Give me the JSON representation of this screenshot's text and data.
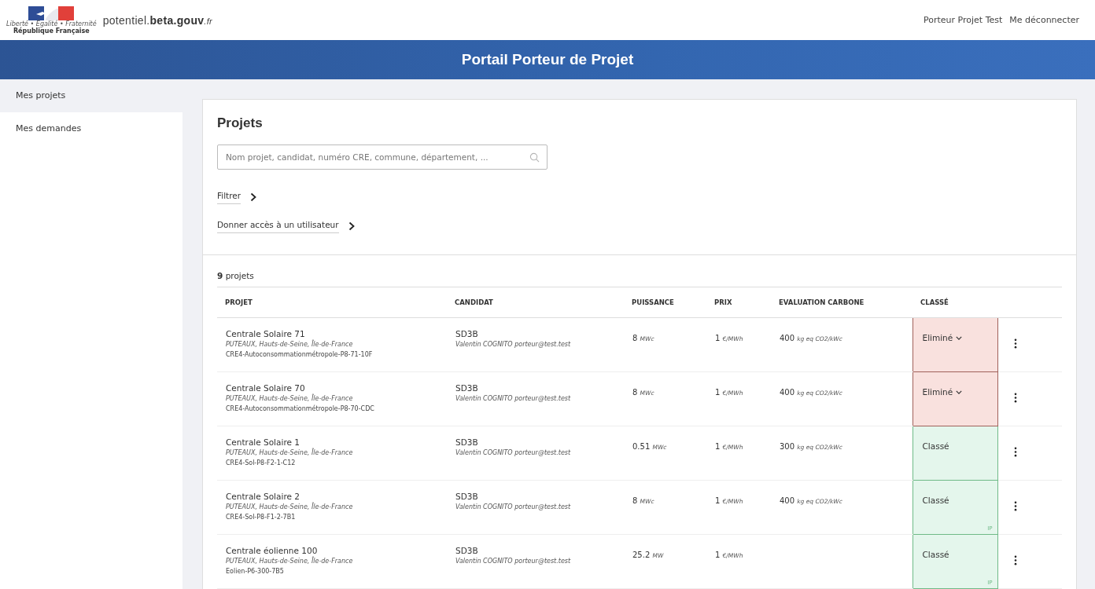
{
  "header": {
    "logo": {
      "motto": "Liberté • Égalité • Fraternité",
      "republic": "République Française"
    },
    "site": {
      "name": "potentiel.",
      "bold": "beta.gouv",
      "suffix": ".fr"
    },
    "links": [
      "Porteur Projet Test",
      "Me déconnecter"
    ]
  },
  "banner": {
    "title": "Portail Porteur de Projet"
  },
  "sidebar": {
    "items": [
      {
        "label": "Mes projets",
        "selected": true
      },
      {
        "label": "Mes demandes",
        "selected": false
      }
    ]
  },
  "main": {
    "title": "Projets",
    "search": {
      "placeholder": "Nom projet, candidat, numéro CRE, commune, département, ..."
    },
    "toggles": [
      "Filtrer",
      "Donner accès à un utilisateur"
    ],
    "count": "**9** projets",
    "table": {
      "columns": [
        "PROJET",
        "CANDIDAT",
        "PUISSANCE",
        "PRIX",
        "EVALUATION CARBONE",
        "CLASSÉ"
      ],
      "rows": [
        {
          "name": "Centrale Solaire 71",
          "location": "PUTEAUX, Hauts-de-Seine, Île-de-France",
          "code": "CRE4-Autoconsommationmétropole-P8-71-10F",
          "candidate": "SD3B",
          "contact": "Valentin COGNITO porteur@test.test",
          "power": {
            "value": "8",
            "unit": "MWc"
          },
          "price": {
            "value": "1",
            "unit": "€/MWh"
          },
          "carbon": {
            "value": "400",
            "unit": "kg eq CO2/kWc"
          },
          "status": {
            "kind": "elimine",
            "label": "Eliminé",
            "dropdown": true
          }
        },
        {
          "name": "Centrale Solaire 70",
          "location": "PUTEAUX, Hauts-de-Seine, Île-de-France",
          "code": "CRE4-Autoconsommationmétropole-P8-70-CDC",
          "candidate": "SD3B",
          "contact": "Valentin COGNITO porteur@test.test",
          "power": {
            "value": "8",
            "unit": "MWc"
          },
          "price": {
            "value": "1",
            "unit": "€/MWh"
          },
          "carbon": {
            "value": "400",
            "unit": "kg eq CO2/kWc"
          },
          "status": {
            "kind": "elimine",
            "label": "Eliminé",
            "dropdown": true
          }
        },
        {
          "name": "Centrale Solaire 1",
          "location": "PUTEAUX, Hauts-de-Seine, Île-de-France",
          "code": "CRE4-Sol-P8-F2-1-C12",
          "candidate": "SD3B",
          "contact": "Valentin COGNITO porteur@test.test",
          "power": {
            "value": "0.51",
            "unit": "MWc"
          },
          "price": {
            "value": "1",
            "unit": "€/MWh"
          },
          "carbon": {
            "value": "300",
            "unit": "kg eq CO2/kWc"
          },
          "status": {
            "kind": "classe",
            "label": "Classé",
            "dropdown": false
          }
        },
        {
          "name": "Centrale Solaire 2",
          "location": "PUTEAUX, Hauts-de-Seine, Île-de-France",
          "code": "CRE4-Sol-P8-F1-2-7B1",
          "candidate": "SD3B",
          "contact": "Valentin COGNITO porteur@test.test",
          "power": {
            "value": "8",
            "unit": "MWc"
          },
          "price": {
            "value": "1",
            "unit": "€/MWh"
          },
          "carbon": {
            "value": "400",
            "unit": "kg eq CO2/kWc"
          },
          "status": {
            "kind": "classe",
            "label": "Classé",
            "dropdown": false,
            "badge": "IP"
          }
        },
        {
          "name": "Centrale éolienne 100",
          "location": "PUTEAUX, Hauts-de-Seine, Île-de-France",
          "code": "Eolien-P6-300-7B5",
          "candidate": "SD3B",
          "contact": "Valentin COGNITO porteur@test.test",
          "power": {
            "value": "25.2",
            "unit": "MW"
          },
          "price": {
            "value": "1",
            "unit": "€/MWh"
          },
          "status": {
            "kind": "classe",
            "label": "Classé",
            "dropdown": false,
            "badge": "IP"
          }
        }
      ]
    }
  }
}
